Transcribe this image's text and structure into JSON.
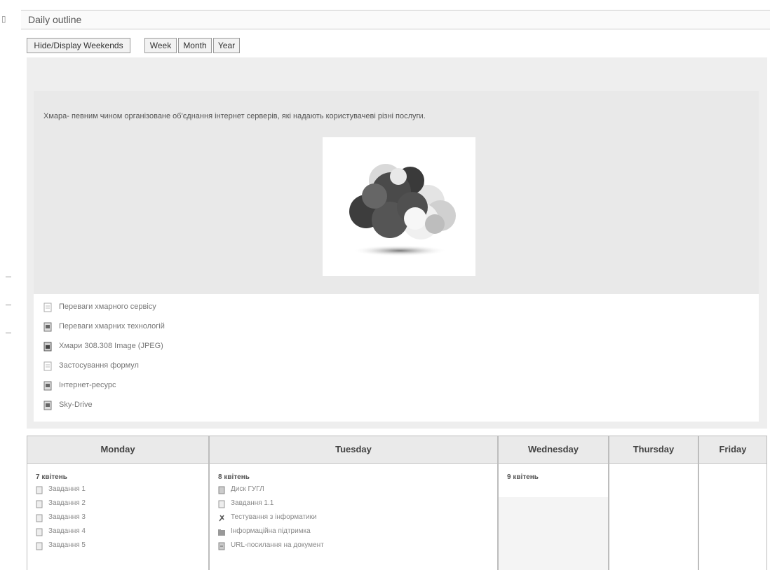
{
  "header": {
    "title": "Daily outline"
  },
  "controls": {
    "hide_weekends": "Hide/Display Weekends",
    "week": "Week",
    "month": "Month",
    "year": "Year"
  },
  "summary": {
    "text": "Хмара- певним чином організоване об'єднання інтернет серверів, які надають користувачеві різні послуги."
  },
  "resources": [
    {
      "label": "Переваги хмарного сервісу",
      "icon": "document-icon"
    },
    {
      "label": "Переваги хмарних технологій",
      "icon": "file-icon"
    },
    {
      "label": "Хмари 308.308 Image (JPEG)",
      "icon": "image-icon"
    },
    {
      "label": "Застосування формул",
      "icon": "document-icon"
    },
    {
      "label": "Інтернет-ресурс",
      "icon": "file-icon"
    },
    {
      "label": "Sky-Drive",
      "icon": "file-icon"
    }
  ],
  "week": {
    "days": [
      {
        "name": "Monday",
        "date": "7 квітень",
        "items": [
          "Завдання 1",
          "Завдання 2",
          "Завдання 3",
          "Завдання 4",
          "Завдання 5"
        ]
      },
      {
        "name": "Tuesday",
        "date": "8 квітень",
        "items": [
          "Диск ГУГЛ",
          "Завдання 1.1",
          "Тестування з інформатики",
          "Інформаційна підтримка",
          "URL-посилання на документ"
        ]
      },
      {
        "name": "Wednesday",
        "date": "9 квітень",
        "items": []
      },
      {
        "name": "Thursday",
        "date": "",
        "items": []
      },
      {
        "name": "Friday",
        "date": "",
        "items": []
      }
    ]
  },
  "colors": {
    "panel_bg": "#eeeeee",
    "summary_bg": "#e9e9e9",
    "header_bg": "#eaeaea"
  }
}
